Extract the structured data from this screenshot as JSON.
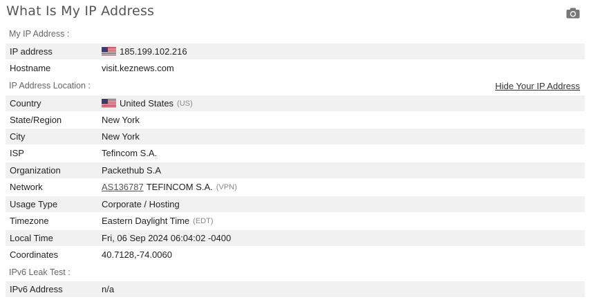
{
  "page": {
    "title": "What Is My IP Address"
  },
  "sections": {
    "my_ip": "My IP Address :",
    "location": "IP Address Location :",
    "ipv6": "IPv6 Leak Test :"
  },
  "hide_ip_link": "Hide Your IP Address",
  "ip": {
    "ip_label": "IP address",
    "ip_value": "185.199.102.216",
    "hostname_label": "Hostname",
    "hostname_value": "visit.keznews.com"
  },
  "location": {
    "country_label": "Country",
    "country_value": "United States",
    "country_code": "(US)",
    "state_label": "State/Region",
    "state_value": "New York",
    "city_label": "City",
    "city_value": "New York",
    "isp_label": "ISP",
    "isp_value": "Tefincom S.A.",
    "org_label": "Organization",
    "org_value": "Packethub S.A",
    "network_label": "Network",
    "network_asn": "AS136787",
    "network_name": "TEFINCOM S.A.",
    "network_tag": "(VPN)",
    "usage_label": "Usage Type",
    "usage_value": "Corporate / Hosting",
    "tz_label": "Timezone",
    "tz_value": "Eastern Daylight Time",
    "tz_abbr": "(EDT)",
    "localtime_label": "Local Time",
    "localtime_value": "Fri, 06 Sep 2024 06:04:02 -0400",
    "coords_label": "Coordinates",
    "coords_value": "40.7128,-74.0060"
  },
  "ipv6": {
    "address_label": "IPv6 Address",
    "address_value": "n/a"
  },
  "icons": {
    "camera": "camera-icon",
    "flag": "us-flag-icon"
  },
  "colors": {
    "row_shade": "#f1f1f1",
    "title": "#555555",
    "muted": "#888888"
  }
}
